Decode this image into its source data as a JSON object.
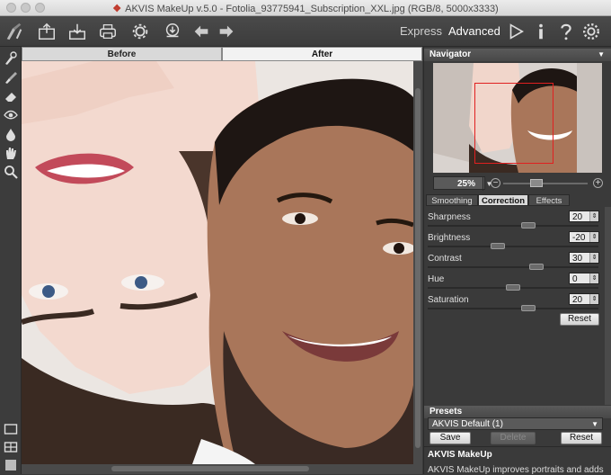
{
  "window": {
    "title": "AKVIS MakeUp v.5.0 - Fotolia_93775941_Subscription_XXL.jpg (RGB/8, 5000x3333)"
  },
  "toolbar": {
    "buttons": [
      "open-icon",
      "save-icon",
      "batch-icon",
      "print-icon",
      "settings-icon",
      "share-icon",
      "undo-icon",
      "redo-icon"
    ],
    "modes": {
      "express": "Express",
      "advanced": "Advanced"
    },
    "right_icons": [
      "run-icon",
      "info-icon",
      "help-icon",
      "preferences-icon"
    ]
  },
  "left_tools": [
    "makeup-brush-icon",
    "brush-icon",
    "eraser-icon",
    "eye-icon",
    "drop-icon",
    "hand-icon",
    "zoom-icon"
  ],
  "view_tabs": {
    "before": "Before",
    "after": "After"
  },
  "navigator": {
    "title": "Navigator",
    "zoom": "25%"
  },
  "panel_tabs": {
    "smoothing": "Smoothing",
    "correction": "Correction",
    "effects": "Effects"
  },
  "correction": {
    "params": [
      {
        "label": "Sharpness",
        "value": "20",
        "level": 0.6
      },
      {
        "label": "Brightness",
        "value": "-20",
        "level": 0.4
      },
      {
        "label": "Contrast",
        "value": "30",
        "level": 0.65
      },
      {
        "label": "Hue",
        "value": "0",
        "level": 0.5
      },
      {
        "label": "Saturation",
        "value": "20",
        "level": 0.6
      }
    ],
    "reset_label": "Reset"
  },
  "presets": {
    "title": "Presets",
    "selected": "AKVIS Default (1)",
    "save_label": "Save",
    "delete_label": "Delete",
    "reset_label": "Reset"
  },
  "info": {
    "title": "AKVIS MakeUp",
    "text": "AKVIS MakeUp improves portraits and adds"
  },
  "colors": {
    "accent_red": "#e02020",
    "panel_bg": "#3a3a3a"
  }
}
